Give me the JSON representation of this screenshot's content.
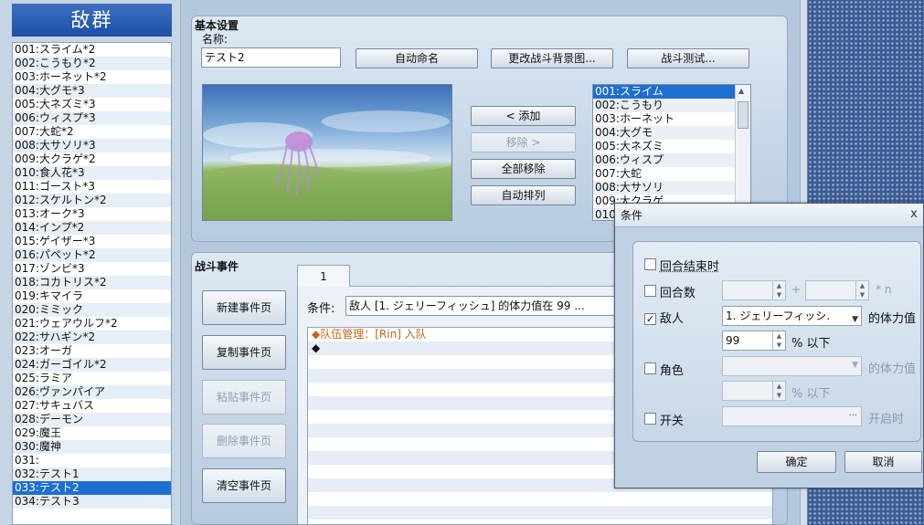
{
  "left_title": "敌群",
  "troops": [
    "001:スライム*2",
    "002:こうもり*2",
    "003:ホーネット*2",
    "004:大グモ*3",
    "005:大ネズミ*3",
    "006:ウィスプ*3",
    "007:大蛇*2",
    "008:大サソリ*3",
    "009:大クラゲ*2",
    "010:食人花*3",
    "011:ゴースト*3",
    "012:スケルトン*2",
    "013:オーク*3",
    "014:インプ*2",
    "015:ゲイザー*3",
    "016:パペット*2",
    "017:ゾンビ*3",
    "018:コカトリス*2",
    "019:キマイラ",
    "020:ミミック",
    "021:ウェアウルフ*2",
    "022:サハギン*2",
    "023:オーガ",
    "024:ガーゴイル*2",
    "025:ラミア",
    "026:ヴァンパイア",
    "027:サキュバス",
    "028:デーモン",
    "029:魔王",
    "030:魔神",
    "031:",
    "032:テスト1",
    "033:テスト2",
    "034:テスト3"
  ],
  "selected_troop_index": 32,
  "basic": {
    "section_title": "基本设置",
    "name_label": "名称:",
    "name_value": "テスト2",
    "auto_name_button": "自动命名",
    "change_bg_button": "更改战斗背景图...",
    "battle_test_button": "战斗测试..."
  },
  "buttons": {
    "add": "< 添加",
    "remove": "移除 >",
    "clear": "全部移除",
    "arrange": "自动排列"
  },
  "enemies": [
    "001:スライム",
    "002:こうもり",
    "003:ホーネット",
    "004:大グモ",
    "005:大ネズミ",
    "006:ウィスプ",
    "007:大蛇",
    "008:大サソリ",
    "009:大クラゲ",
    "010:"
  ],
  "events": {
    "section_title": "战斗事件",
    "tab_label": "1",
    "new_page": "新建事件页",
    "copy_page": "复制事件页",
    "paste_page": "粘贴事件页",
    "delete_page": "删除事件页",
    "clear_page": "清空事件页",
    "condition_label": "条件:",
    "condition_value": "敌人 [1. ジェリーフィッシュ] 的体力值在 99 ...",
    "command1": "◆队伍管理：[Rin] 入队",
    "command2": "◆"
  },
  "dialog": {
    "title": "条件",
    "close": "x",
    "turn_end": "回合结束时",
    "turn": "回合数",
    "turn_plus": "+",
    "turn_n": "* n",
    "enemy": "敌人",
    "enemy_value": "1. ジェリーフィッシ.",
    "enemy_hp": "的体力值",
    "hp_value": "99",
    "percent_below": "% 以下",
    "actor": "角色",
    "actor_hp": "的体力值",
    "actor_percent_below": "% 以下",
    "switch": "开关",
    "switch_on": "开启时",
    "ellipsis": "...",
    "ok": "确定",
    "cancel": "取消"
  },
  "colors": {
    "selection": "#1e6fd0",
    "title_bar": "#1b4fa8",
    "command_text": "#c86414"
  }
}
